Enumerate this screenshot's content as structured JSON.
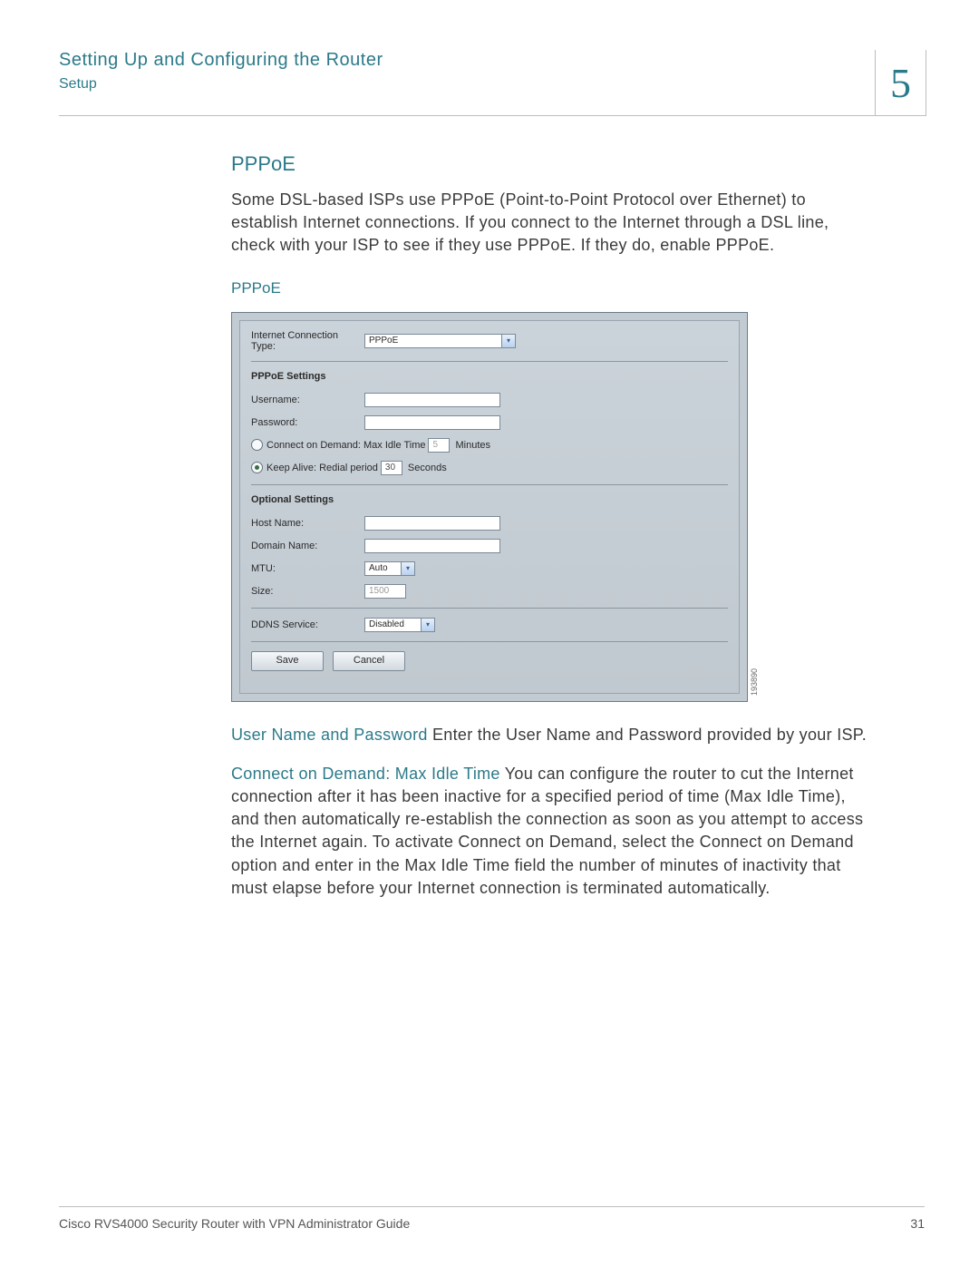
{
  "header": {
    "title": "Setting Up and Configuring the Router",
    "subtitle": "Setup",
    "chapter_number": "5"
  },
  "section": {
    "heading": "PPPoE",
    "intro": "Some DSL-based ISPs use PPPoE (Point-to-Point Protocol over Ethernet) to establish Internet connections. If you connect to the Internet through a DSL line, check with your ISP to see if they use PPPoE. If they do, enable PPPoE.",
    "figure_caption": "PPPoE"
  },
  "panel": {
    "conn_type_label": "Internet Connection Type:",
    "conn_type_value": "PPPoE",
    "pppoe_settings_label": "PPPoE Settings",
    "username_label": "Username:",
    "password_label": "Password:",
    "connect_on_demand_label": "Connect on Demand: Max Idle Time",
    "connect_on_demand_value": "5",
    "connect_on_demand_unit": "Minutes",
    "keep_alive_label": "Keep Alive: Redial period",
    "keep_alive_value": "30",
    "keep_alive_unit": "Seconds",
    "optional_settings_label": "Optional Settings",
    "host_name_label": "Host Name:",
    "domain_name_label": "Domain Name:",
    "mtu_label": "MTU:",
    "mtu_value": "Auto",
    "size_label": "Size:",
    "size_value": "1500",
    "ddns_label": "DDNS Service:",
    "ddns_value": "Disabled",
    "save_btn": "Save",
    "cancel_btn": "Cancel",
    "image_id": "193890"
  },
  "paragraphs": {
    "p1_label": "User Name and Password",
    "p1_text": " Enter the User Name and Password provided by your ISP.",
    "p2_label": "Connect on Demand: Max Idle Time",
    "p2_text": " You can configure the router to cut the Internet connection after it has been inactive for a specified period of time (Max Idle Time), and then automatically re-establish the connection as soon as you attempt to access the Internet again. To activate Connect on Demand, select the Connect on Demand option and enter in the Max Idle Time field the number of minutes of inactivity that must elapse before your Internet connection is terminated automatically."
  },
  "footer": {
    "doc_title": "Cisco RVS4000 Security Router with VPN Administrator Guide",
    "page_number": "31"
  }
}
